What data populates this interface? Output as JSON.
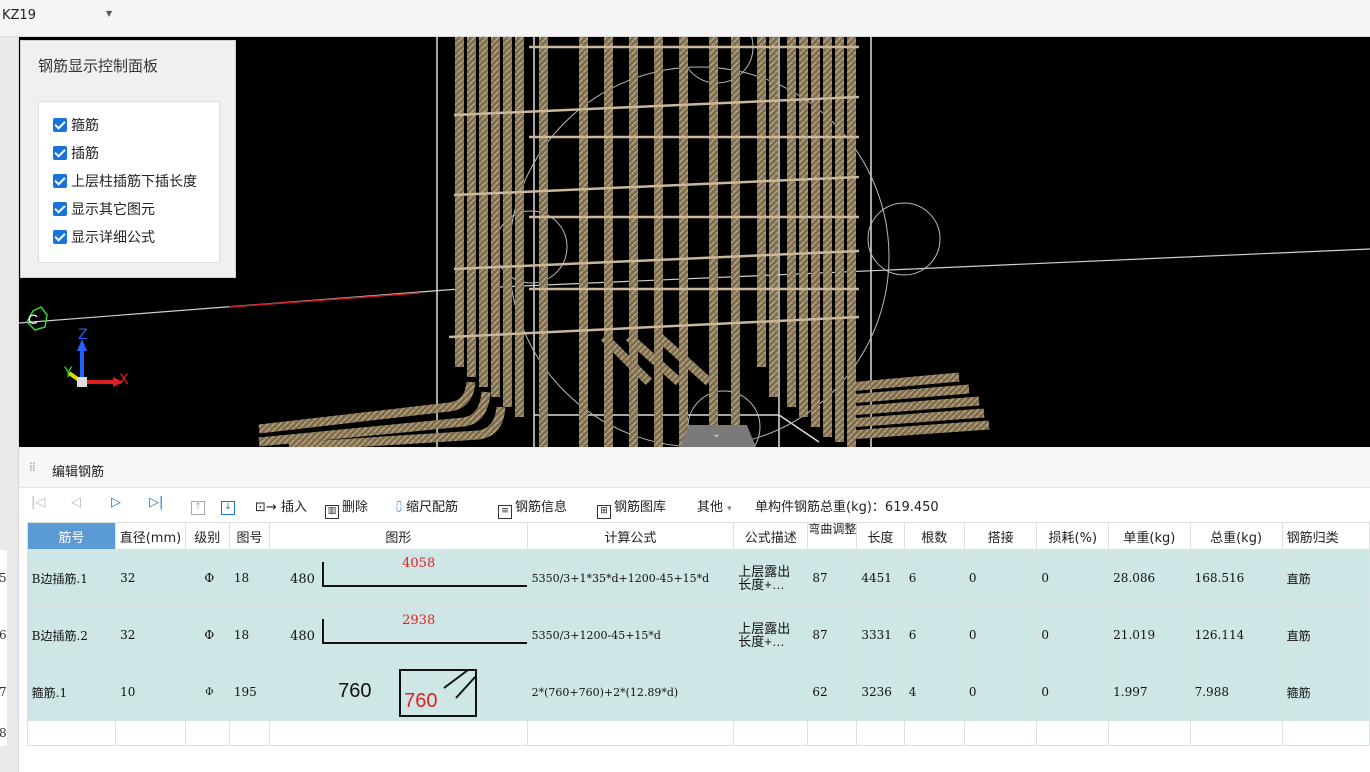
{
  "component": {
    "selected": "KZ19"
  },
  "control_panel": {
    "title": "钢筋显示控制面板",
    "options": [
      {
        "label": "箍筋",
        "checked": true
      },
      {
        "label": "插筋",
        "checked": true
      },
      {
        "label": "上层柱插筋下插长度",
        "checked": true
      },
      {
        "label": "显示其它图元",
        "checked": true
      },
      {
        "label": "显示详细公式",
        "checked": true
      }
    ]
  },
  "viewport": {
    "axis_marker": "C",
    "axes": {
      "z": "Z",
      "y": "Y",
      "x": "X"
    }
  },
  "editor": {
    "title": "编辑钢筋",
    "toolbar": {
      "insert": "插入",
      "delete": "删除",
      "scale": "缩尺配筋",
      "info": "钢筋信息",
      "library": "钢筋图库",
      "other": "其他",
      "weight_label": "单构件钢筋总重(kg)：619.450"
    },
    "columns": [
      "筋号",
      "直径(mm)",
      "级别",
      "图号",
      "图形",
      "计算公式",
      "公式描述",
      "弯曲调整",
      "长度",
      "根数",
      "搭接",
      "损耗(%)",
      "单重(kg)",
      "总重(kg)",
      "钢筋归类"
    ],
    "rows": [
      {
        "num": "5",
        "name": "B边插筋.1",
        "diameter": "32",
        "grade": "Φ",
        "fig": "18",
        "shape_left": "480",
        "shape_len": "4058",
        "formula": "5350/3+1*35*d+1200-45+15*d",
        "desc1": "上层露出",
        "desc2": "长度+…",
        "bend": "87",
        "length": "4451",
        "count": "6",
        "lap": "0",
        "loss": "0",
        "unit_w": "28.086",
        "total_w": "168.516",
        "type": "直筋"
      },
      {
        "num": "6",
        "name": "B边插筋.2",
        "diameter": "32",
        "grade": "Φ",
        "fig": "18",
        "shape_left": "480",
        "shape_len": "2938",
        "formula": "5350/3+1200-45+15*d",
        "desc1": "上层露出",
        "desc2": "长度+…",
        "bend": "87",
        "length": "3331",
        "count": "6",
        "lap": "0",
        "loss": "0",
        "unit_w": "21.019",
        "total_w": "126.114",
        "type": "直筋"
      },
      {
        "num": "7",
        "name": "箍筋.1",
        "diameter": "10",
        "grade": "Φ",
        "fig": "195",
        "shape_left": "760",
        "shape_len": "760",
        "formula": "2*(760+760)+2*(12.89*d)",
        "desc1": "",
        "desc2": "",
        "bend": "62",
        "length": "3236",
        "count": "4",
        "lap": "0",
        "loss": "0",
        "unit_w": "1.997",
        "total_w": "7.988",
        "type": "箍筋"
      }
    ],
    "empty_row_num": "8"
  },
  "colors": {
    "accent": "#1a73d9",
    "row_bg": "#cfe6e7",
    "header_sel": "#5b9bd5",
    "shape_text": "#e02020"
  }
}
